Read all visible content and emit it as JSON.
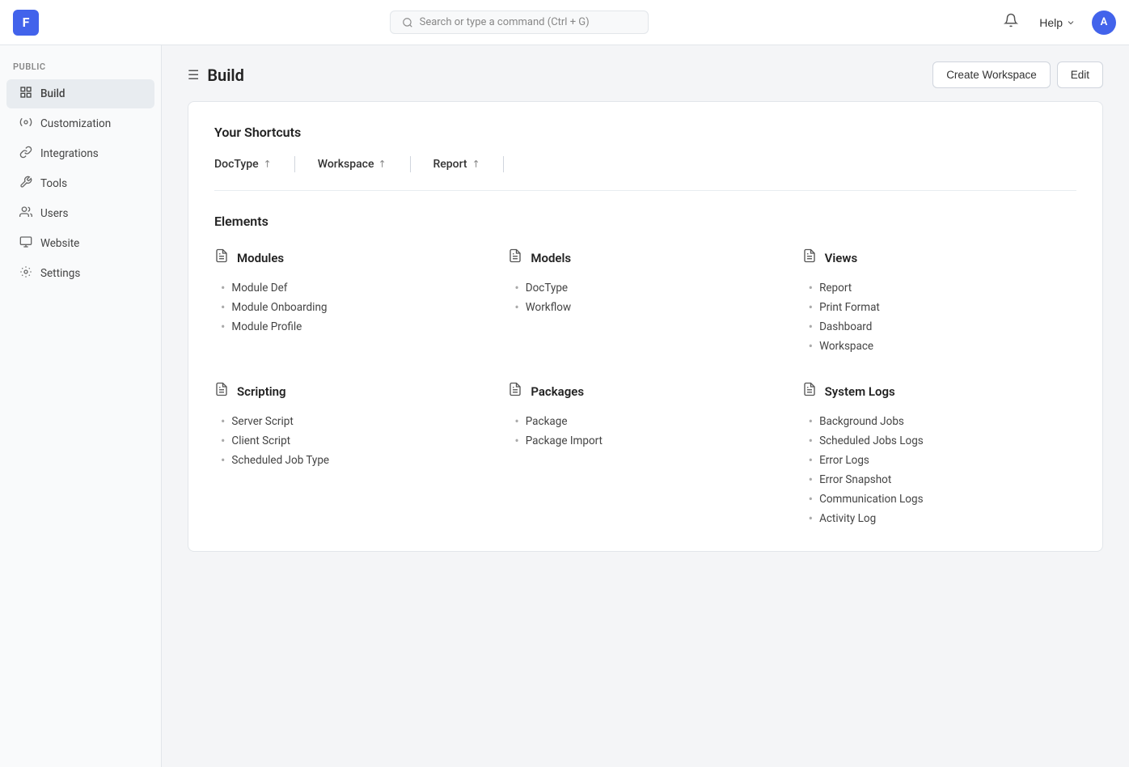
{
  "topbar": {
    "logo_text": "F",
    "search_placeholder": "Search or type a command (Ctrl + G)",
    "help_label": "Help",
    "avatar_text": "A"
  },
  "page": {
    "menu_icon": "☰",
    "title": "Build",
    "create_workspace_label": "Create Workspace",
    "edit_label": "Edit"
  },
  "sidebar": {
    "section_label": "PUBLIC",
    "items": [
      {
        "label": "Build",
        "icon": "⚙",
        "active": true
      },
      {
        "label": "Customization",
        "icon": "✦"
      },
      {
        "label": "Integrations",
        "icon": "⟳"
      },
      {
        "label": "Tools",
        "icon": "🔧"
      },
      {
        "label": "Users",
        "icon": "👤"
      },
      {
        "label": "Website",
        "icon": "▭"
      },
      {
        "label": "Settings",
        "icon": "⚙"
      }
    ]
  },
  "shortcuts": {
    "title": "Your Shortcuts",
    "items": [
      {
        "label": "DocType"
      },
      {
        "label": "Workspace"
      },
      {
        "label": "Report"
      }
    ]
  },
  "elements": {
    "title": "Elements",
    "sections": [
      {
        "name": "Modules",
        "items": [
          "Module Def",
          "Module Onboarding",
          "Module Profile"
        ]
      },
      {
        "name": "Models",
        "items": [
          "DocType",
          "Workflow"
        ]
      },
      {
        "name": "Views",
        "items": [
          "Report",
          "Print Format",
          "Dashboard",
          "Workspace"
        ]
      },
      {
        "name": "Scripting",
        "items": [
          "Server Script",
          "Client Script",
          "Scheduled Job Type"
        ]
      },
      {
        "name": "Packages",
        "items": [
          "Package",
          "Package Import"
        ]
      },
      {
        "name": "System Logs",
        "items": [
          "Background Jobs",
          "Scheduled Jobs Logs",
          "Error Logs",
          "Error Snapshot",
          "Communication Logs",
          "Activity Log"
        ]
      }
    ]
  }
}
